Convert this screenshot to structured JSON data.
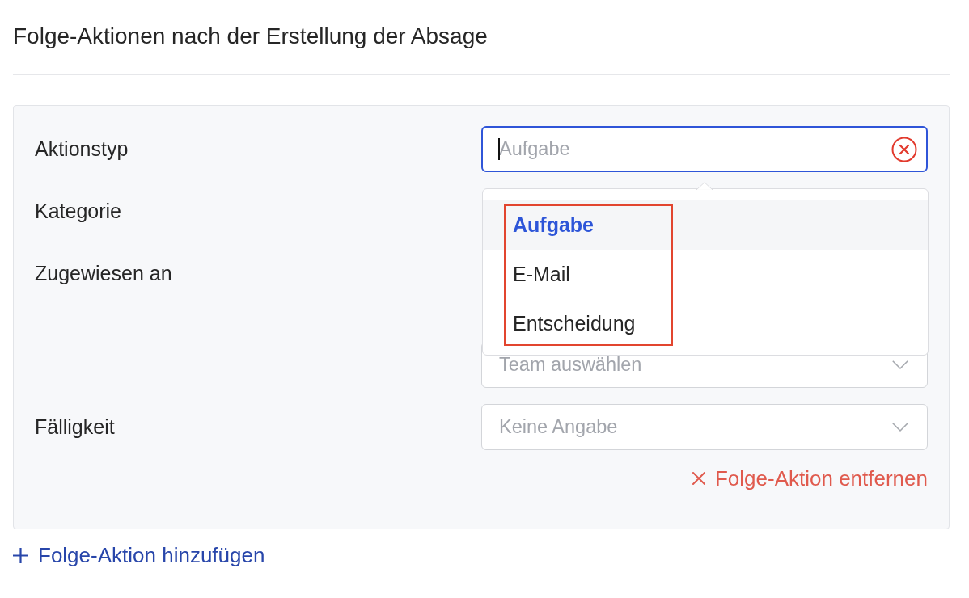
{
  "title": "Folge-Aktionen nach der Erstellung der Absage",
  "follow_up_action": {
    "rows": [
      {
        "label": "Aktionstyp",
        "controls": [
          {
            "kind": "combobox",
            "placeholder": "Aufgabe",
            "focused": true,
            "dropdown": {
              "open": true,
              "highlight_frame": true,
              "options": [
                {
                  "label": "Aufgabe",
                  "selected": true
                },
                {
                  "label": "E-Mail",
                  "selected": false
                },
                {
                  "label": "Entscheidung",
                  "selected": false
                }
              ]
            }
          }
        ]
      },
      {
        "label": "Kategorie",
        "controls": [
          {
            "kind": "covered"
          }
        ]
      },
      {
        "label": "Zugewiesen an",
        "controls": [
          {
            "kind": "covered"
          },
          {
            "kind": "select",
            "placeholder": "Team auswählen"
          }
        ]
      },
      {
        "label": "Fälligkeit",
        "controls": [
          {
            "kind": "select",
            "placeholder": "Keine Angabe"
          }
        ]
      }
    ],
    "remove_link": "Folge-Aktion entfernen"
  },
  "add_link": "Folge-Aktion hinzufügen"
}
